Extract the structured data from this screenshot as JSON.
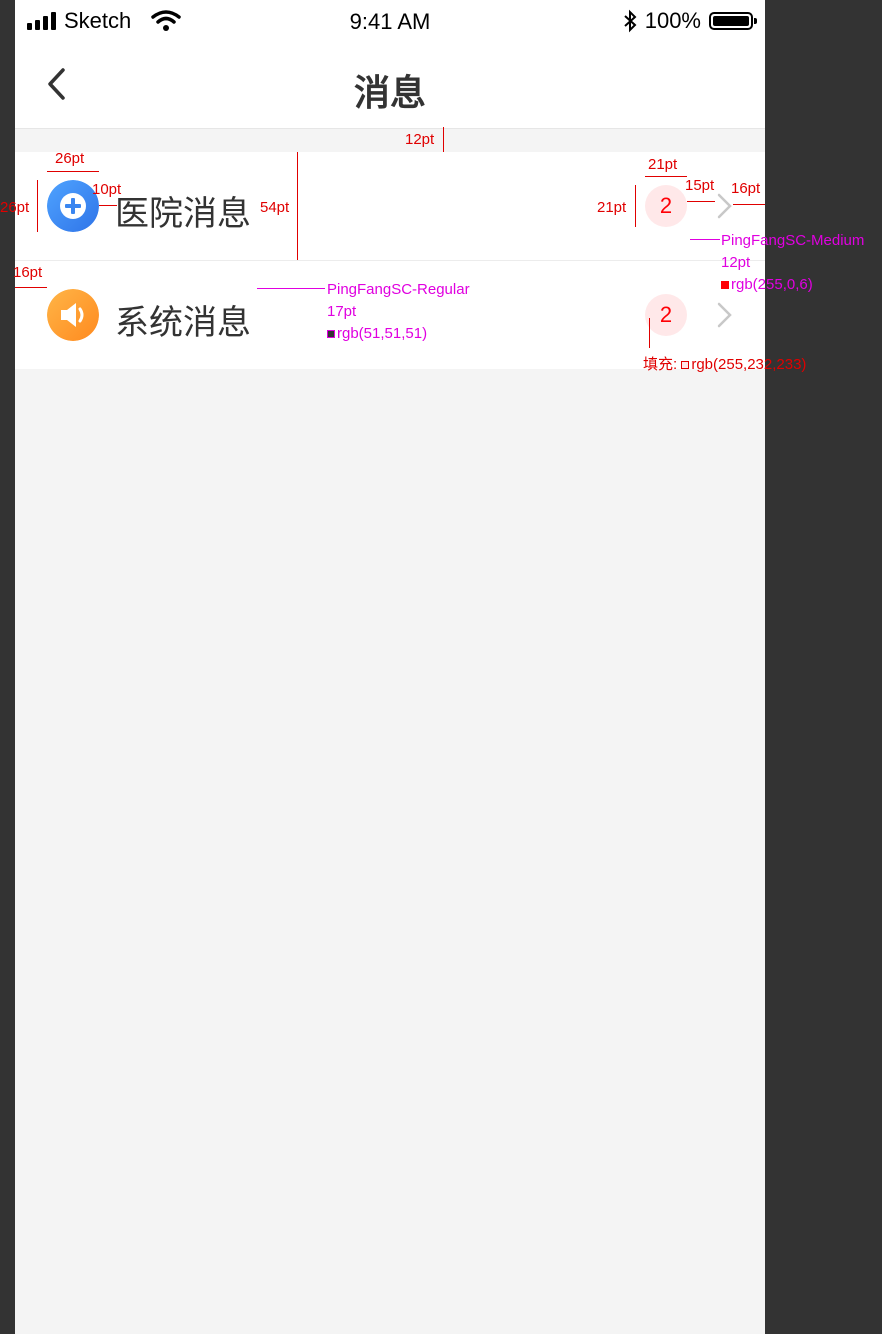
{
  "status_bar": {
    "carrier": "Sketch",
    "time": "9:41 AM",
    "battery": "100%"
  },
  "nav": {
    "title": "消息"
  },
  "items": [
    {
      "label": "医院消息",
      "badge": "2",
      "icon": "plus-circle-icon",
      "icon_color": "#3a86f0"
    },
    {
      "label": "系统消息",
      "badge": "2",
      "icon": "speaker-icon",
      "icon_color": "#ff9d2e"
    }
  ],
  "annotations": {
    "gap_top": "12pt",
    "icon_width": "26pt",
    "icon_height": "26pt",
    "icon_gap": "10pt",
    "row_height": "54pt",
    "badge_width": "21pt",
    "badge_height": "21pt",
    "arrow_gap": "15pt",
    "right_margin": "16pt",
    "left_margin": "16pt",
    "badge_font": "PingFangSC-Medium",
    "badge_size": "12pt",
    "badge_color": "rgb(255,0,6)",
    "label_font": "PingFangSC-Regular",
    "label_size": "17pt",
    "label_color": "rgb(51,51,51)",
    "fill_label": "填充:",
    "fill_color": "rgb(255,232,233)"
  },
  "colors": {
    "badge_bg": "#ffe8e9",
    "badge_text": "#ff0006",
    "text": "#333333"
  }
}
